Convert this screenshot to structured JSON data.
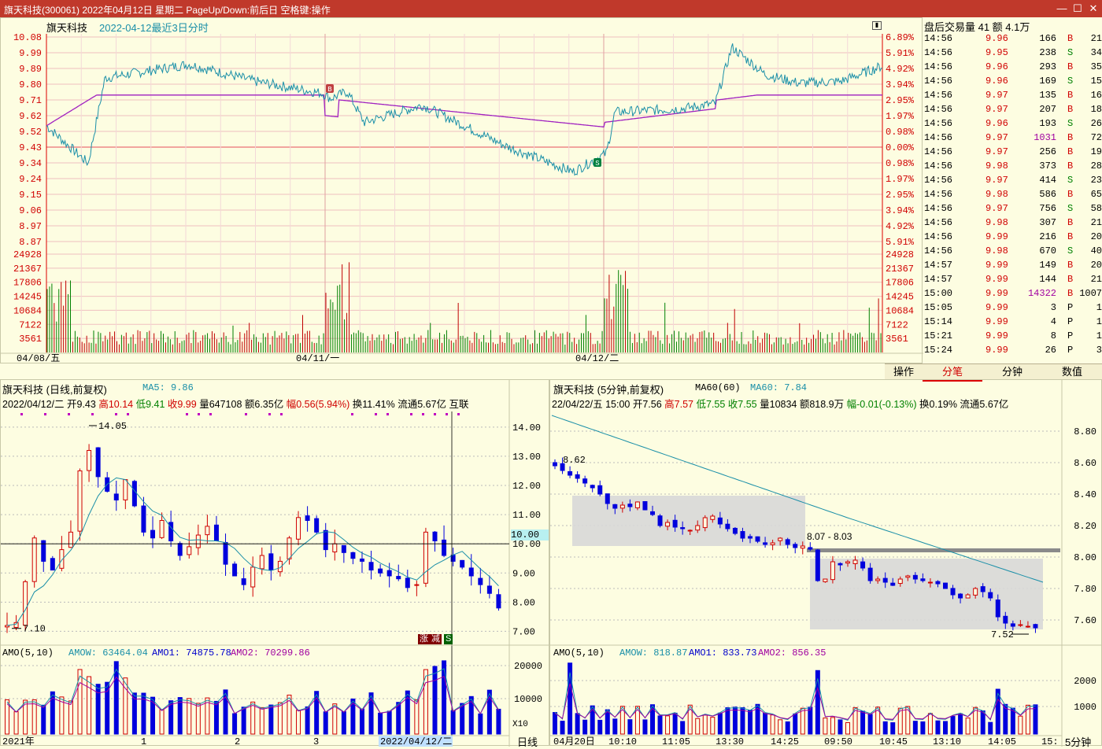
{
  "window": {
    "title": "旗天科技(300061) 2022年04月12日 星期二 PageUp/Down:前后日 空格键:操作"
  },
  "intraday": {
    "name": "旗天科技",
    "subtitle": "2022-04-12最近3日分时",
    "price_ticks": [
      "10.08",
      "9.99",
      "9.89",
      "9.80",
      "9.71",
      "9.62",
      "9.52",
      "9.43",
      "9.34",
      "9.24",
      "9.15",
      "9.06",
      "8.97",
      "8.87"
    ],
    "pct_ticks": [
      "6.89%",
      "5.91%",
      "4.92%",
      "3.94%",
      "2.95%",
      "1.97%",
      "0.98%",
      "0.00%",
      "0.98%",
      "1.97%",
      "2.95%",
      "3.94%",
      "4.92%",
      "5.91%"
    ],
    "vol_ticks": [
      "24928",
      "21367",
      "17806",
      "14245",
      "10684",
      "7122",
      "3561"
    ],
    "date_labels": [
      "04/08/五",
      "04/11/一",
      "04/12/二"
    ],
    "markers": [
      "B",
      "S"
    ]
  },
  "trades": {
    "header": "盘后交易量 41 额 4.1万",
    "rows": [
      {
        "time": "14:56",
        "price": "9.96",
        "vol": "166",
        "side": "B",
        "num": "21"
      },
      {
        "time": "14:56",
        "price": "9.95",
        "vol": "238",
        "side": "S",
        "num": "34"
      },
      {
        "time": "14:56",
        "price": "9.96",
        "vol": "293",
        "side": "B",
        "num": "35"
      },
      {
        "time": "14:56",
        "price": "9.96",
        "vol": "169",
        "side": "S",
        "num": "15"
      },
      {
        "time": "14:56",
        "price": "9.97",
        "vol": "135",
        "side": "B",
        "num": "16"
      },
      {
        "time": "14:56",
        "price": "9.97",
        "vol": "207",
        "side": "B",
        "num": "18"
      },
      {
        "time": "14:56",
        "price": "9.96",
        "vol": "193",
        "side": "S",
        "num": "26"
      },
      {
        "time": "14:56",
        "price": "9.97",
        "vol": "1031",
        "side": "B",
        "num": "72"
      },
      {
        "time": "14:56",
        "price": "9.97",
        "vol": "256",
        "side": "B",
        "num": "19"
      },
      {
        "time": "14:56",
        "price": "9.98",
        "vol": "373",
        "side": "B",
        "num": "28"
      },
      {
        "time": "14:56",
        "price": "9.97",
        "vol": "414",
        "side": "S",
        "num": "23"
      },
      {
        "time": "14:56",
        "price": "9.98",
        "vol": "586",
        "side": "B",
        "num": "65"
      },
      {
        "time": "14:56",
        "price": "9.97",
        "vol": "756",
        "side": "S",
        "num": "58"
      },
      {
        "time": "14:56",
        "price": "9.98",
        "vol": "307",
        "side": "B",
        "num": "21"
      },
      {
        "time": "14:56",
        "price": "9.99",
        "vol": "216",
        "side": "B",
        "num": "20"
      },
      {
        "time": "14:56",
        "price": "9.98",
        "vol": "670",
        "side": "S",
        "num": "40"
      },
      {
        "time": "14:57",
        "price": "9.99",
        "vol": "149",
        "side": "B",
        "num": "20"
      },
      {
        "time": "14:57",
        "price": "9.99",
        "vol": "144",
        "side": "B",
        "num": "21"
      },
      {
        "time": "15:00",
        "price": "9.99",
        "vol": "14322",
        "side": "B",
        "num": "1007"
      },
      {
        "time": "15:05",
        "price": "9.99",
        "vol": "3",
        "side": "P",
        "num": "1"
      },
      {
        "time": "15:14",
        "price": "9.99",
        "vol": "4",
        "side": "P",
        "num": "1"
      },
      {
        "time": "15:21",
        "price": "9.99",
        "vol": "8",
        "side": "P",
        "num": "1"
      },
      {
        "time": "15:24",
        "price": "9.99",
        "vol": "26",
        "side": "P",
        "num": "3"
      }
    ]
  },
  "tabs": {
    "op": "操作",
    "items": [
      "分笔",
      "分钟",
      "数值"
    ]
  },
  "daily": {
    "header": "旗天科技 (日线,前复权)",
    "ma5": "MA5: 9.86",
    "info_prefix": "2022/04/12/二 开9.43 ",
    "info_high": "高10.14",
    "info_low": " 低9.41",
    "info_close": " 收9.99",
    "info_mid": " 量647108 额6.35亿 ",
    "info_amp": "幅0.56(5.94%)",
    "info_tail": " 换11.41% 流通5.67亿 互联",
    "yticks": [
      "14.00",
      "13.00",
      "12.00",
      "11.00",
      "10.00",
      "9.00",
      "8.00",
      "7.00"
    ],
    "high_label": "14.05",
    "low_label": "7.10",
    "cursor_price": "10.00",
    "amo_title": "AMO(5,10)",
    "amow": "AMOW: 63464.04",
    "amo1": "AMO1: 74875.78",
    "amo2": "AMO2: 70299.86",
    "amo_ticks": [
      "20000",
      "10000"
    ],
    "amo_unit": "X10",
    "xlabels": [
      "2021年",
      "1",
      "2",
      "3",
      "2022/04/12/二"
    ],
    "period": "日线",
    "badges": [
      "涨",
      "减",
      "S"
    ]
  },
  "min5": {
    "header": "旗天科技 (5分钟,前复权)",
    "ma60": "MA60(60)",
    "ma60v": "MA60: 7.84",
    "info_prefix": "22/04/22/五 15:00 开7.56 ",
    "info_high": "高7.57",
    "info_low": " 低7.55",
    "info_close": " 收7.55",
    "info_mid": " 量10834 额818.9万 ",
    "info_amp": "幅-0.01(-0.13%)",
    "info_tail": " 换0.19% 流通5.67亿",
    "yticks": [
      "8.80",
      "8.60",
      "8.40",
      "8.20",
      "8.00",
      "7.80",
      "7.60"
    ],
    "high_label": "8.62",
    "low_label": "7.52",
    "range_label": "8.07 - 8.03",
    "amo_title": "AMO(5,10)",
    "amow": "AMOW: 818.87",
    "amo1": "AMO1: 833.73",
    "amo2": "AMO2: 856.35",
    "amo_ticks": [
      "2000",
      "1000"
    ],
    "xlabels": [
      "04月20日",
      "10:10",
      "11:05",
      "13:30",
      "14:25",
      "09:50",
      "10:45",
      "13:10",
      "14:05",
      "15:"
    ],
    "period": "5分钟"
  }
}
